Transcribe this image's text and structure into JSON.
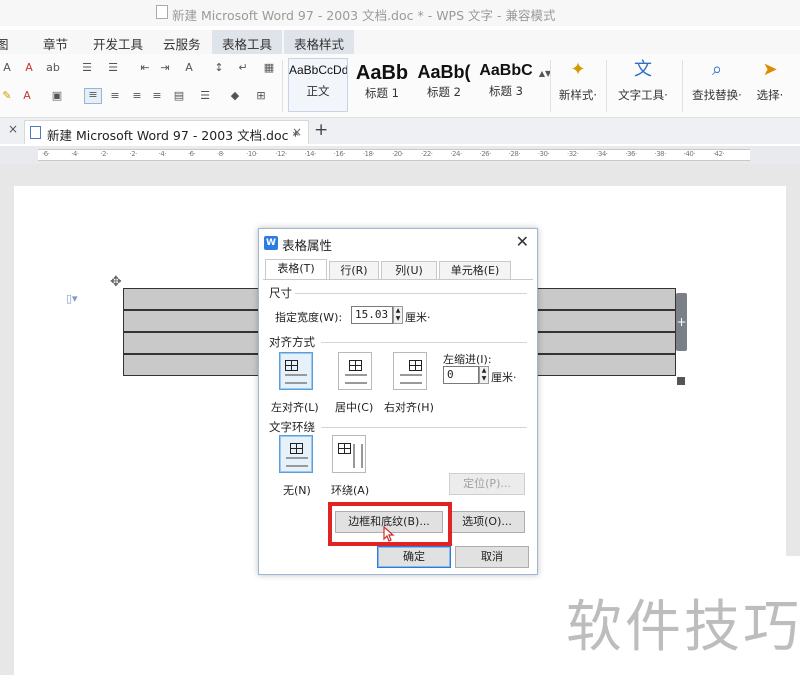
{
  "window": {
    "title": "新建 Microsoft Word 97 - 2003 文档.doc * - WPS 文字 - 兼容模式"
  },
  "menu": {
    "tabs": [
      "图",
      "章节",
      "开发工具",
      "云服务",
      "表格工具",
      "表格样式"
    ]
  },
  "ribbon": {
    "styles": [
      {
        "sample": "AaBbCcDd",
        "name": "正文"
      },
      {
        "sample": "AaBb",
        "name": "标题 1"
      },
      {
        "sample": "AaBb(",
        "name": "标题 2"
      },
      {
        "sample": "AaBbC",
        "name": "标题 3"
      }
    ],
    "new_style": "新样式·",
    "text_tools": "文字工具·",
    "find_replace": "查找替换·",
    "select": "选择·"
  },
  "doc_tab": {
    "label": "新建 Microsoft Word 97 - 2003 文档.doc *",
    "close": "×",
    "add": "+"
  },
  "ruler": {
    "ticks": [
      "6",
      "4",
      "2",
      "2",
      "4",
      "6",
      "8",
      "10",
      "12",
      "14",
      "16",
      "18",
      "20",
      "22",
      "24",
      "26",
      "28",
      "30",
      "32",
      "34",
      "36",
      "38",
      "40",
      "42"
    ]
  },
  "dialog": {
    "title": "表格属性",
    "close": "✕",
    "tabs": [
      "表格(T)",
      "行(R)",
      "列(U)",
      "单元格(E)"
    ],
    "size_section": "尺寸",
    "width_label": "指定宽度(W):",
    "width_value": "15.03",
    "width_unit": "厘米·",
    "align_section": "对齐方式",
    "align_options": [
      "左对齐(L)",
      "居中(C)",
      "右对齐(H)"
    ],
    "indent_label": "左缩进(I):",
    "indent_value": "0",
    "indent_unit": "厘米·",
    "wrap_section": "文字环绕",
    "wrap_options": [
      "无(N)",
      "环绕(A)"
    ],
    "position_button": "定位(P)...",
    "borders_button": "边框和底纹(B)...",
    "options_button": "选项(O)...",
    "ok_button": "确定",
    "cancel_button": "取消"
  },
  "watermark": "软件技巧",
  "colors": {
    "accent": "#2d7de0",
    "highlight": "#e02424",
    "table_fill": "#c9c9c9"
  }
}
